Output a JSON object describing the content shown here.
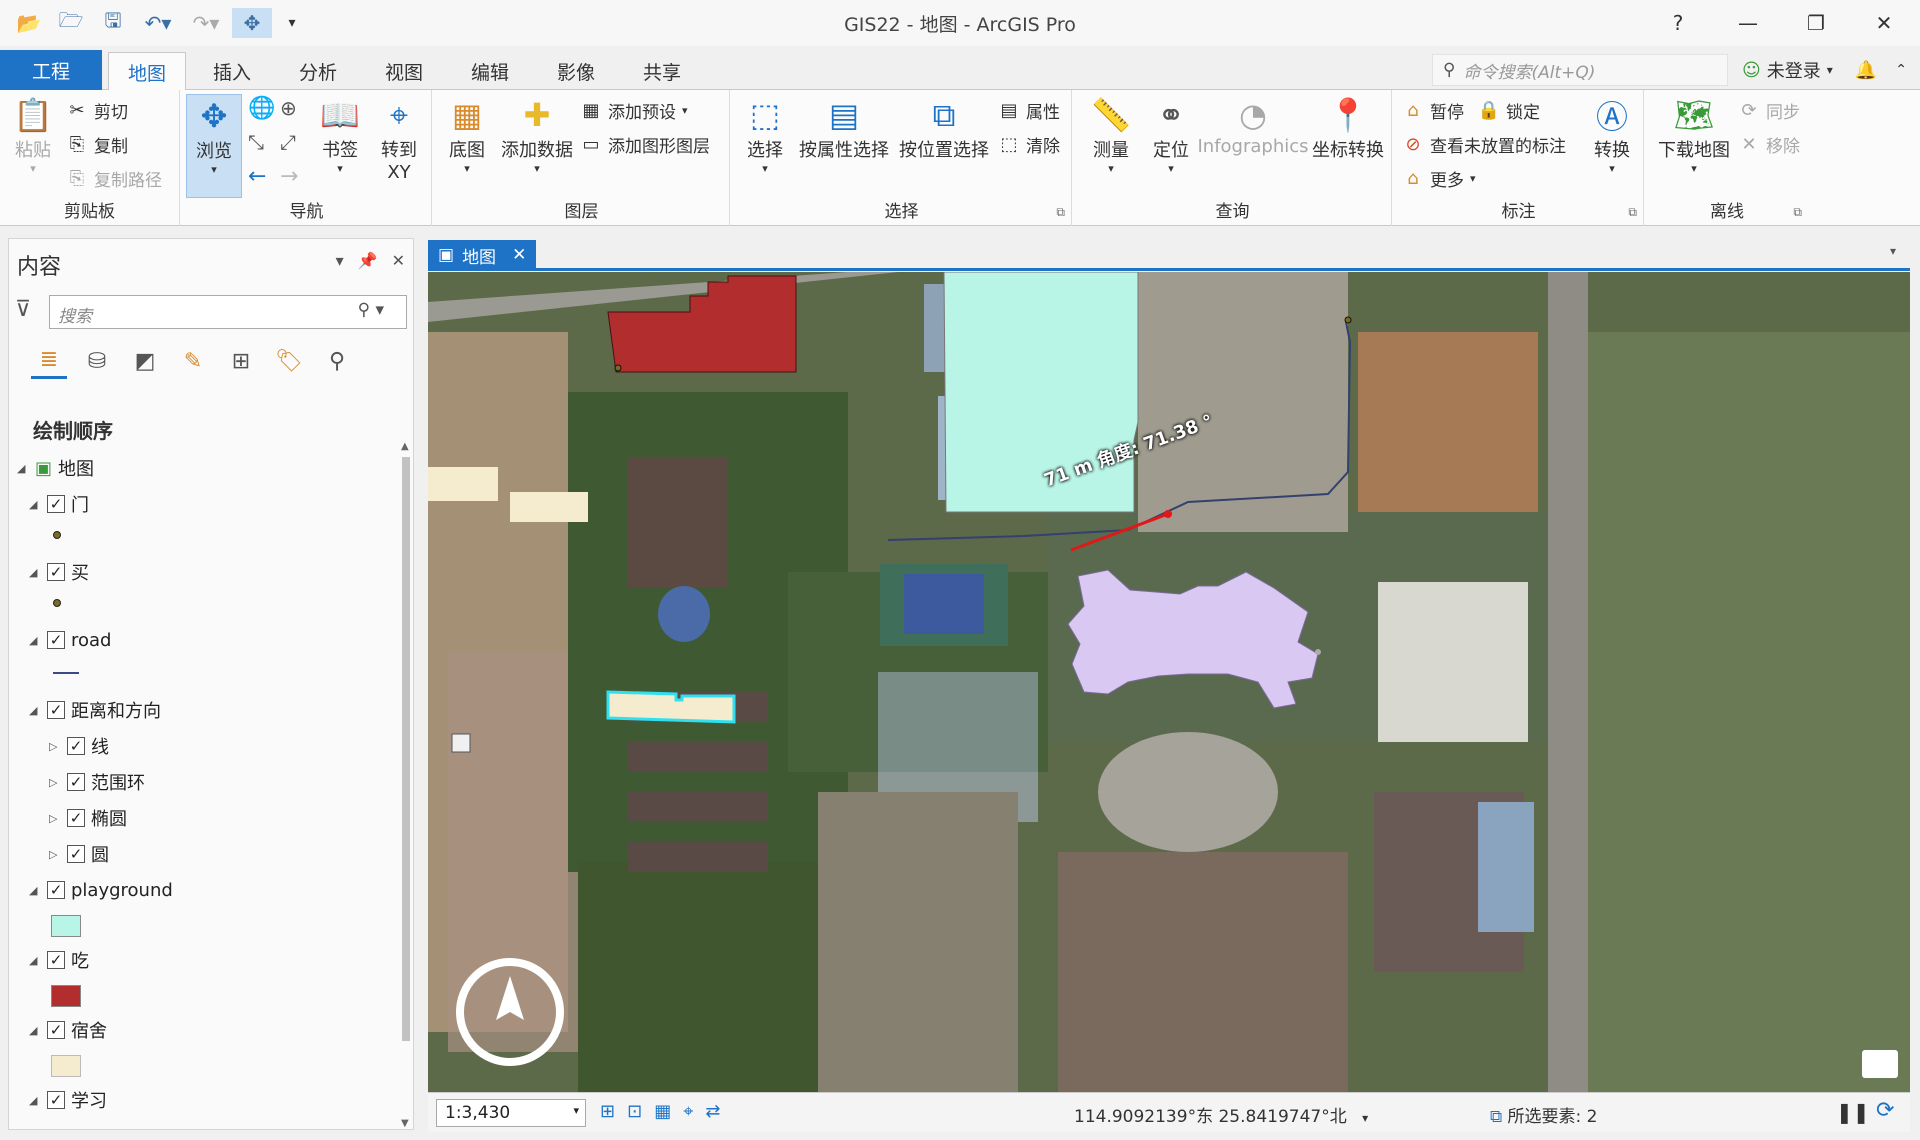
{
  "app": {
    "title": "GIS22 - 地图 - ArcGIS Pro"
  },
  "window_controls": {
    "help": "?",
    "minimize": "—",
    "restore": "❐",
    "close": "✕"
  },
  "ribbon_tabs": [
    "工程",
    "地图",
    "插入",
    "分析",
    "视图",
    "编辑",
    "影像",
    "共享"
  ],
  "command_search": {
    "placeholder": "命令搜索(Alt+Q)"
  },
  "user": {
    "login_label": "未登录"
  },
  "ribbon": {
    "clipboard": {
      "label": "剪贴板",
      "paste": "粘贴",
      "cut": "剪切",
      "copy": "复制",
      "copy_path": "复制路径"
    },
    "navigate": {
      "label": "导航",
      "explore": "浏览",
      "bookmarks": "书签",
      "goto_line1": "转到",
      "goto_line2": "XY"
    },
    "layer": {
      "label": "图层",
      "basemap": "底图",
      "add_data": "添加数据",
      "add_preset": "添加预设",
      "add_graphics": "添加图形图层"
    },
    "selection": {
      "label": "选择",
      "select": "选择",
      "by_attr": "按属性选择",
      "by_loc": "按位置选择",
      "attributes": "属性",
      "clear": "清除"
    },
    "inquiry": {
      "label": "查询",
      "measure": "测量",
      "locate": "定位",
      "infographics": "Infographics",
      "coord_convert": "坐标转换"
    },
    "labeling": {
      "label": "标注",
      "pause": "暂停",
      "lock": "锁定",
      "unplaced": "查看未放置的标注",
      "more": "更多",
      "convert": "转换"
    },
    "offline": {
      "label": "离线",
      "download": "下载地图",
      "sync": "同步",
      "remove": "移除"
    }
  },
  "contents": {
    "title": "内容",
    "search_placeholder": "搜索",
    "draw_order": "绘制顺序",
    "layers": [
      {
        "name": "地图"
      },
      {
        "name": "门"
      },
      {
        "name": "买"
      },
      {
        "name": "road"
      },
      {
        "name": "距离和方向"
      },
      {
        "name": "线"
      },
      {
        "name": "范围环"
      },
      {
        "name": "椭圆"
      },
      {
        "name": "圆"
      },
      {
        "name": "playground"
      },
      {
        "name": "吃"
      },
      {
        "name": "宿舍"
      },
      {
        "name": "学习"
      }
    ]
  },
  "map_view": {
    "tab_label": "地图",
    "measure_label": "71 m 角度: 71.38 °",
    "scale": "1:3,430",
    "coordinates": "114.9092139°东 25.8419747°北",
    "selected": "所选要素: 2"
  },
  "colors": {
    "accent": "#1e73c7",
    "eat_fill": "#b22d2d",
    "playground_fill": "#b8f5e6",
    "dorm_fill": "#f5ecd0",
    "study_fill": "#d8c8f2"
  }
}
